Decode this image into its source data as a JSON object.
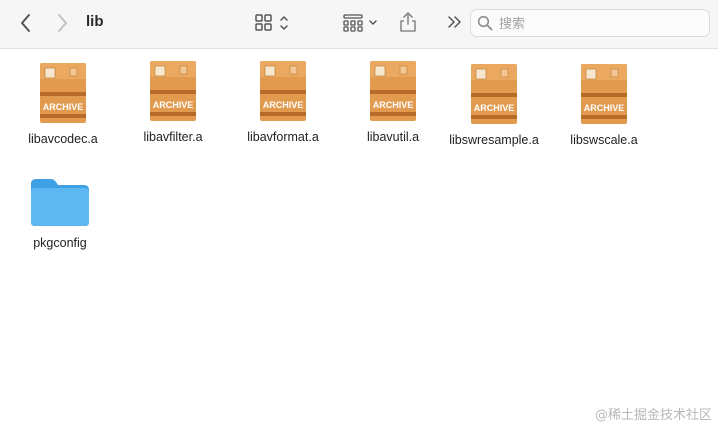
{
  "window": {
    "title": "lib"
  },
  "toolbar": {
    "search_placeholder": "搜索",
    "icons": {
      "back": "chevron-left-icon",
      "forward": "chevron-right-icon",
      "view": "grid-view-icon",
      "group": "group-view-icon",
      "share": "share-icon",
      "more": "overflow-icon",
      "search": "search-icon"
    }
  },
  "files": [
    {
      "name": "libavcodec.a",
      "kind": "archive"
    },
    {
      "name": "libavfilter.a",
      "kind": "archive"
    },
    {
      "name": "libavformat.a",
      "kind": "archive"
    },
    {
      "name": "libavutil.a",
      "kind": "archive"
    },
    {
      "name": "libswresample.a",
      "kind": "archive"
    },
    {
      "name": "libswscale.a",
      "kind": "archive"
    },
    {
      "name": "pkgconfig",
      "kind": "folder"
    }
  ],
  "archive_badge": "ARCHIVE",
  "watermark": "@稀土掘金技术社区",
  "colors": {
    "archive": "#e29a4f",
    "archive_dark": "#b86a28",
    "folder": "#5db8f2",
    "folder_dark": "#3fa0e3"
  }
}
